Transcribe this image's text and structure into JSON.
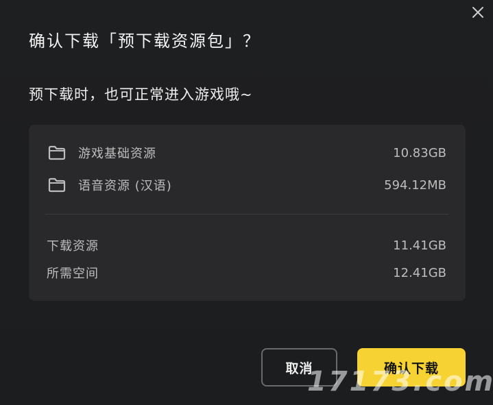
{
  "dialog": {
    "title": "确认下载「预下载资源包」？",
    "subtitle": "预下载时，也可正常进入游戏哦~",
    "close_icon": "close-icon"
  },
  "resources": [
    {
      "icon": "folder-icon",
      "label": "游戏基础资源",
      "size": "10.83GB"
    },
    {
      "icon": "folder-icon",
      "label": "语音资源 (汉语)",
      "size": "594.12MB"
    }
  ],
  "summary": [
    {
      "label": "下载资源",
      "value": "11.41GB"
    },
    {
      "label": "所需空间",
      "value": "12.41GB"
    }
  ],
  "buttons": {
    "cancel": "取消",
    "confirm": "确认下载"
  },
  "watermark": "17173.com",
  "colors": {
    "background": "#1e1f21",
    "panel": "#29292c",
    "accent": "#f6d233",
    "text_primary": "#f3f3f3",
    "text_secondary": "#bdbdbd"
  }
}
